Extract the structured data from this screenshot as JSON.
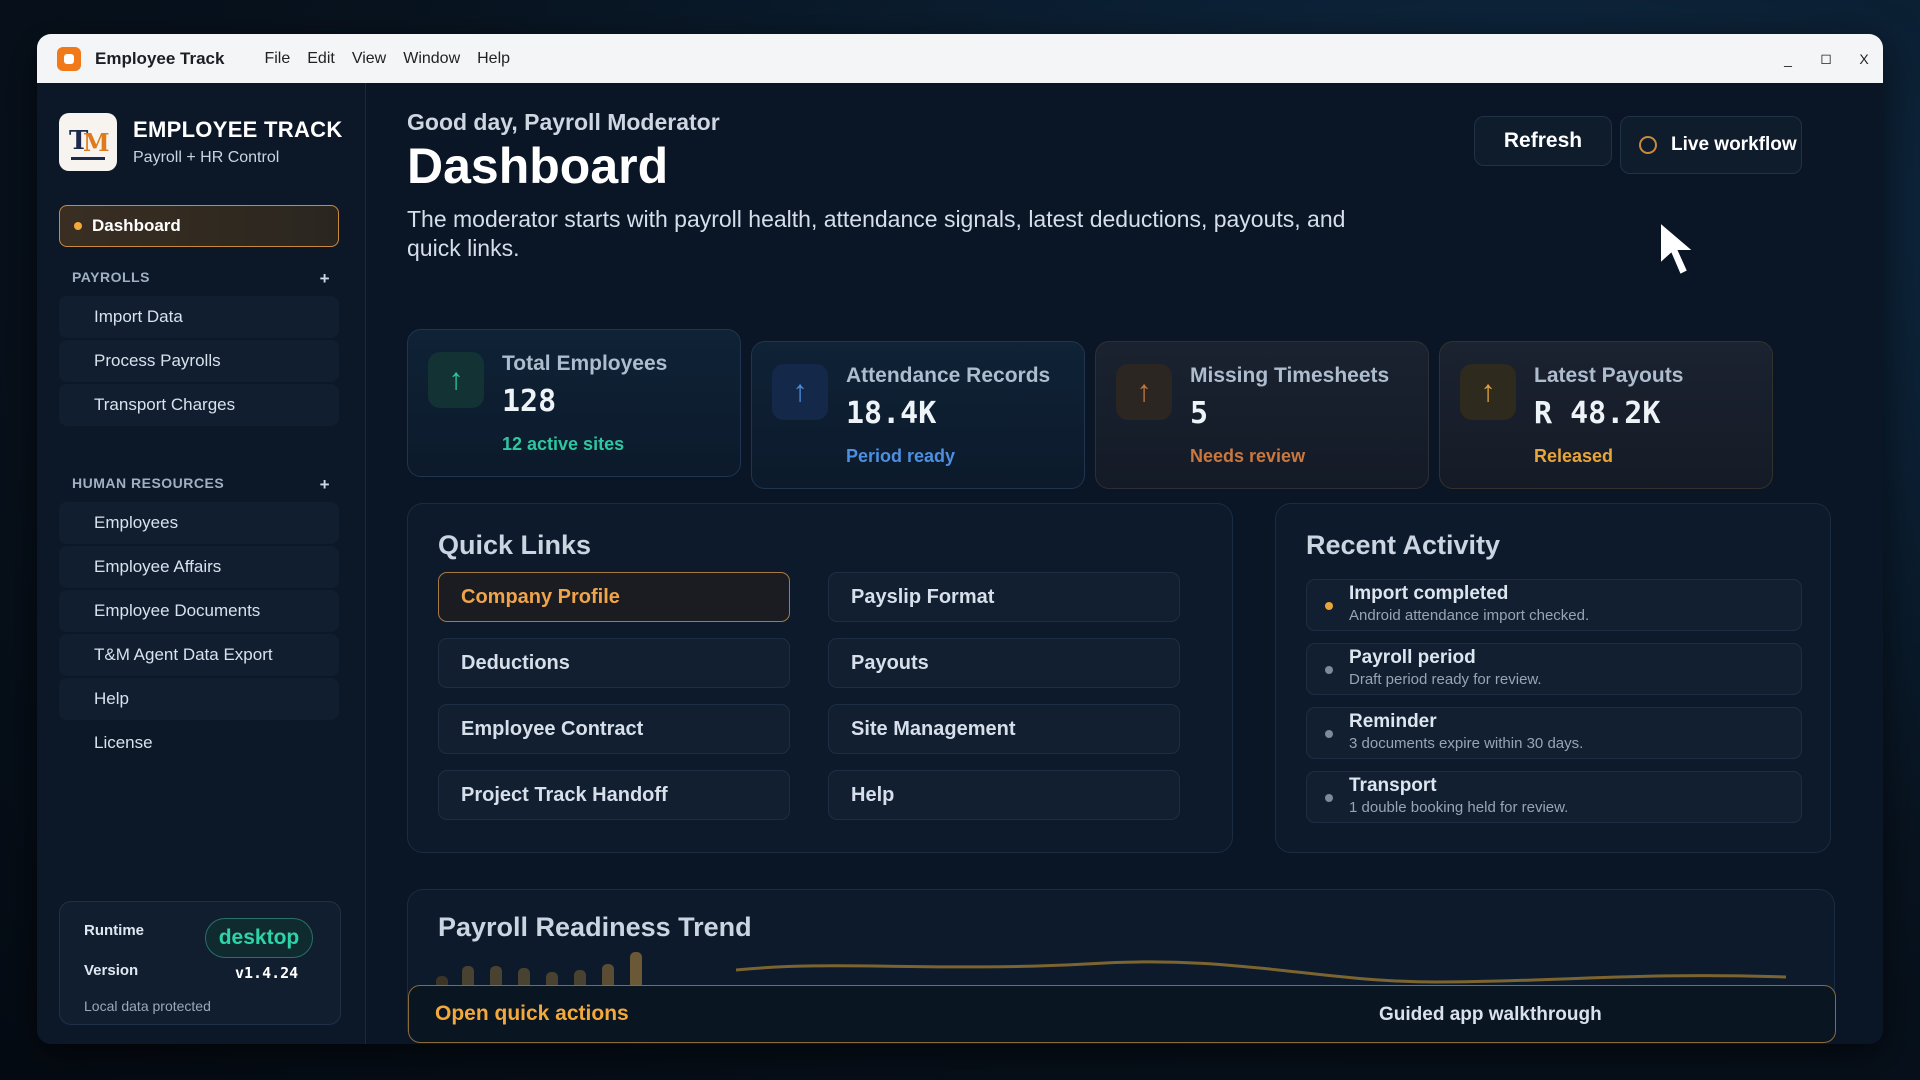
{
  "titlebar": {
    "app_title": "Employee Track",
    "menu": [
      "File",
      "Edit",
      "View",
      "Window",
      "Help"
    ],
    "minimize": "_",
    "maximize": "◻",
    "close": "X"
  },
  "sidebar": {
    "brand_name": "EMPLOYEE TRACK",
    "brand_sub": "Payroll + HR Control",
    "active_item": "Dashboard",
    "sections": [
      {
        "label": "PAYROLLS",
        "toggle": "+",
        "items": [
          "Import Data",
          "Process Payrolls",
          "Transport Charges"
        ]
      },
      {
        "label": "HUMAN RESOURCES",
        "toggle": "+",
        "items": [
          "Employees",
          "Employee Affairs",
          "Employee Documents",
          "T&M Agent Data Export"
        ]
      }
    ],
    "extra_items": [
      "Help",
      "License"
    ],
    "runtime": {
      "runtime_label": "Runtime",
      "runtime_value": "desktop",
      "version_label": "Version",
      "version_value": "v1.4.24",
      "note": "Local data protected"
    }
  },
  "header": {
    "greeting": "Good day, Payroll Moderator",
    "title": "Dashboard",
    "description": "The moderator starts with payroll health, attendance signals, latest deductions, payouts, and quick links.",
    "refresh_label": "Refresh",
    "live_label": "Live workflow"
  },
  "kpis": [
    {
      "label": "Total Employees",
      "value": "128",
      "sub": "12 active sites",
      "accent": "#2fc7a0",
      "icon": "arrow-up-icon"
    },
    {
      "label": "Attendance Records",
      "value": "18.4K",
      "sub": "Period ready",
      "accent": "#4d8fe0",
      "icon": "arrow-up-icon"
    },
    {
      "label": "Missing Timesheets",
      "value": "5",
      "sub": "Needs review",
      "accent": "#c9773e",
      "icon": "arrow-up-icon"
    },
    {
      "label": "Latest Payouts",
      "value": "R 48.2K",
      "sub": "Released",
      "accent": "#e8a53a",
      "icon": "arrow-up-icon"
    }
  ],
  "quick_links": {
    "title": "Quick Links",
    "items": [
      "Company Profile",
      "Payslip Format",
      "Deductions",
      "Payouts",
      "Employee Contract",
      "Site Management",
      "Project Track Handoff",
      "Help"
    ],
    "active": "Company Profile"
  },
  "recent_activity": {
    "title": "Recent Activity",
    "items": [
      {
        "title": "Import completed",
        "desc": "Android attendance import checked.",
        "dot": "#e8a53a"
      },
      {
        "title": "Payroll period",
        "desc": "Draft period ready for review.",
        "dot": "#7e8a98"
      },
      {
        "title": "Reminder",
        "desc": "3 documents expire within 30 days.",
        "dot": "#7e8a98"
      },
      {
        "title": "Transport",
        "desc": "1 double booking held for review.",
        "dot": "#7e8a98"
      }
    ]
  },
  "trend": {
    "title": "Payroll Readiness Trend",
    "open_quick_actions": "Open quick actions",
    "guided": "Guided app walkthrough"
  },
  "colors": {
    "accent_orange": "#f2a83b",
    "teal": "#2fd3a8",
    "panel": "#0d1a2b"
  }
}
